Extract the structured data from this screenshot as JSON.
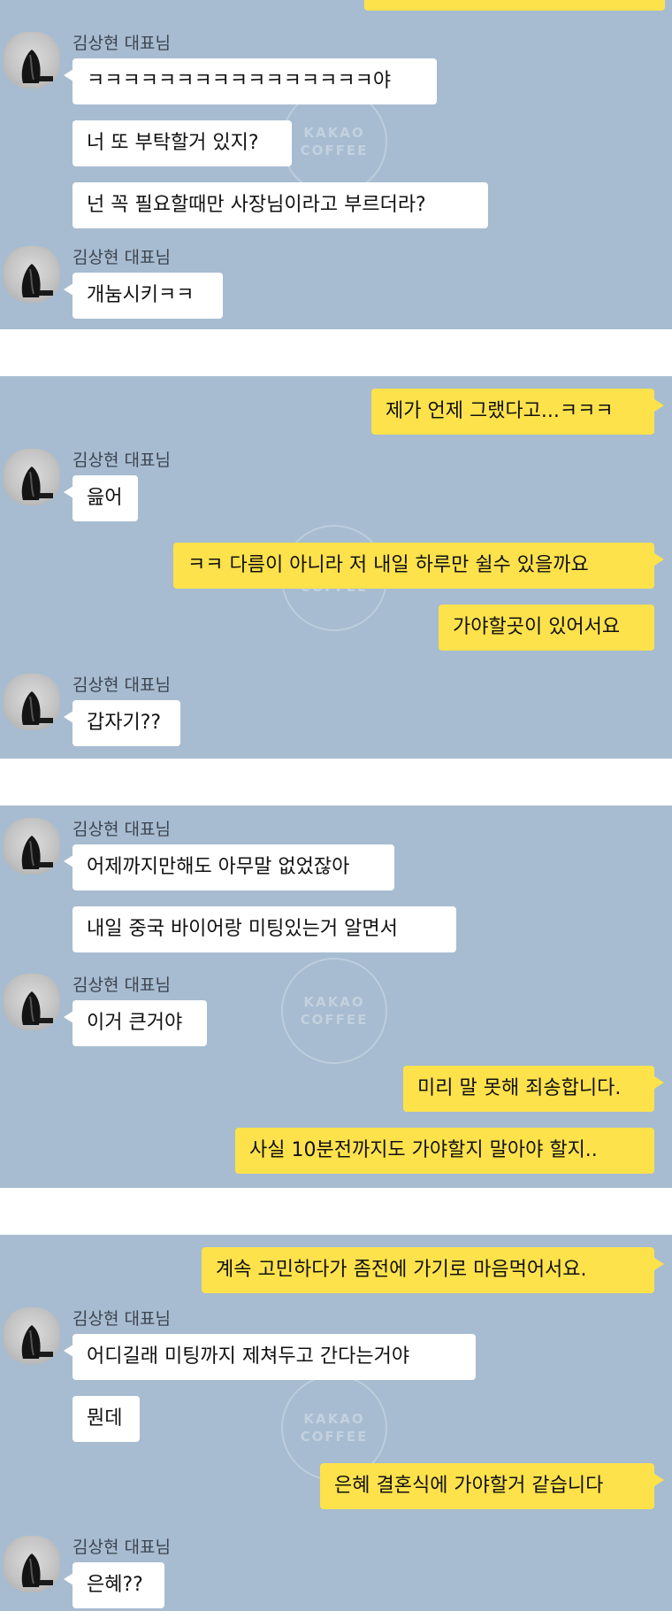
{
  "sender": "김상현 대표님",
  "watermark": "KAKAO\nCOFFEE",
  "colors": {
    "chat_bg": "#a7bcd0",
    "incoming": "#ffffff",
    "outgoing": "#fee24c"
  },
  "panel1": {
    "msg1": "ㅋㅋㅋㅋㅋㅋㅋㅋㅋㅋㅋㅋㅋㅋㅋㅋ야",
    "msg2": "너 또 부탁할거 있지?",
    "msg3": "넌 꼭 필요할때만 사장님이라고 부르더라?",
    "msg4": "개눔시키ㅋㅋ"
  },
  "panel2": {
    "out1": "제가 언제 그랬다고...ㅋㅋㅋ",
    "in1": "읊어",
    "out2": "ㅋㅋ 다름이 아니라 저 내일 하루만 쉴수 있을까요",
    "out3": "가야할곳이 있어서요",
    "in2": "갑자기??"
  },
  "panel3": {
    "in1": "어제까지만해도 아무말 없었잖아",
    "in2": "내일 중국 바이어랑 미팅있는거 알면서",
    "in3": "이거 큰거야",
    "out1": "미리 말 못해 죄송합니다.",
    "out2": "사실 10분전까지도 가야할지 말아야 할지.."
  },
  "panel4": {
    "out1": "계속 고민하다가 좀전에 가기로 마음먹어서요.",
    "in1": "어디길래 미팅까지 제쳐두고 간다는거야",
    "in2": "뭔데",
    "out2": "은혜 결혼식에 가야할거 같습니다",
    "in3": "은혜??"
  }
}
